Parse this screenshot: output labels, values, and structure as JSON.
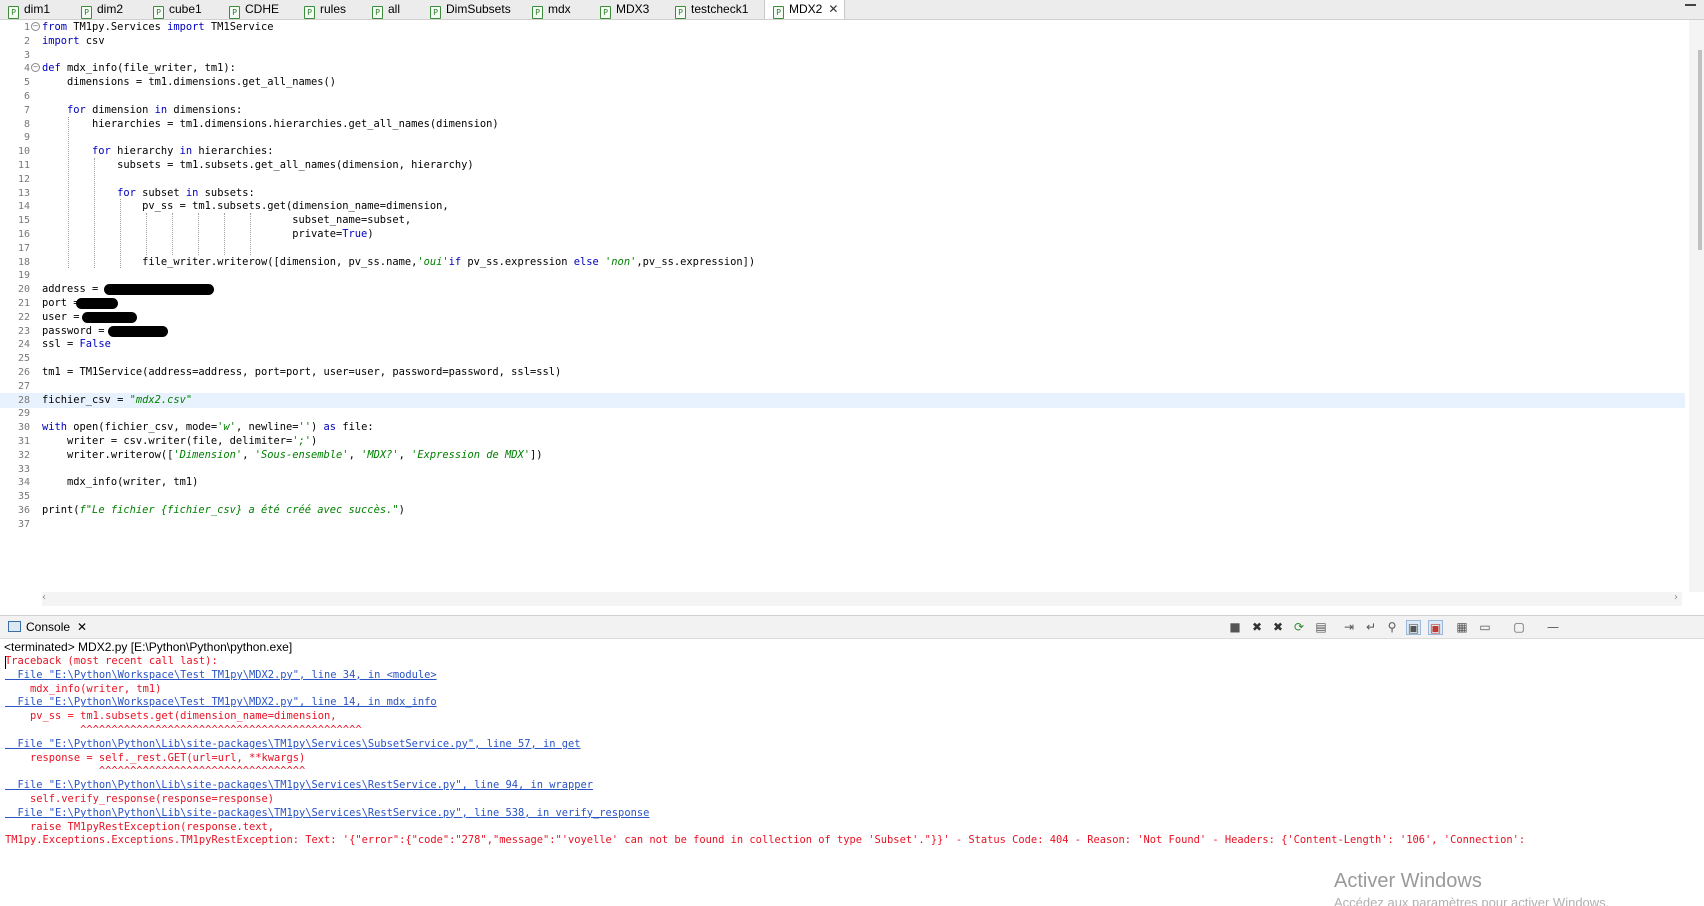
{
  "tabs": [
    {
      "label": "dim1",
      "icon": "python-file-icon",
      "active": false
    },
    {
      "label": "dim2",
      "icon": "python-file-icon",
      "active": false
    },
    {
      "label": "cube1",
      "icon": "python-file-icon",
      "active": false
    },
    {
      "label": "CDHE",
      "icon": "python-file-icon",
      "active": false
    },
    {
      "label": "rules",
      "icon": "python-file-icon",
      "active": false
    },
    {
      "label": "all",
      "icon": "python-file-icon",
      "active": false
    },
    {
      "label": "DimSubsets",
      "icon": "python-file-icon",
      "active": false
    },
    {
      "label": "mdx",
      "icon": "python-file-icon",
      "active": false
    },
    {
      "label": "MDX3",
      "icon": "python-file-icon",
      "active": false
    },
    {
      "label": "testcheck1",
      "icon": "python-file-icon",
      "active": false
    },
    {
      "label": "MDX2",
      "icon": "python-file-icon",
      "active": true
    }
  ],
  "editor": {
    "current_line": 28,
    "lines": [
      {
        "n": "1",
        "fold": true,
        "code": "from TM1py.Services import TM1Service"
      },
      {
        "n": "2",
        "code": "import csv"
      },
      {
        "n": "3",
        "code": ""
      },
      {
        "n": "4",
        "fold": true,
        "code": "def mdx_info(file_writer, tm1):"
      },
      {
        "n": "5",
        "code": "    dimensions = tm1.dimensions.get_all_names()"
      },
      {
        "n": "6",
        "code": ""
      },
      {
        "n": "7",
        "code": "    for dimension in dimensions:"
      },
      {
        "n": "8",
        "code": "        hierarchies = tm1.dimensions.hierarchies.get_all_names(dimension)"
      },
      {
        "n": "9",
        "code": ""
      },
      {
        "n": "10",
        "code": "        for hierarchy in hierarchies:"
      },
      {
        "n": "11",
        "code": "            subsets = tm1.subsets.get_all_names(dimension, hierarchy)"
      },
      {
        "n": "12",
        "code": ""
      },
      {
        "n": "13",
        "code": "            for subset in subsets:"
      },
      {
        "n": "14",
        "code": "                pv_ss = tm1.subsets.get(dimension_name=dimension,"
      },
      {
        "n": "15",
        "code": "                                        subset_name=subset,"
      },
      {
        "n": "16",
        "code": "                                        private=True)"
      },
      {
        "n": "17",
        "code": ""
      },
      {
        "n": "18",
        "code": "                file_writer.writerow([dimension, pv_ss.name,'oui'if pv_ss.expression else 'non',pv_ss.expression])"
      },
      {
        "n": "19",
        "code": ""
      },
      {
        "n": "20",
        "code": "address = "
      },
      {
        "n": "21",
        "code": "port = "
      },
      {
        "n": "22",
        "code": "user = "
      },
      {
        "n": "23",
        "code": "password = "
      },
      {
        "n": "24",
        "code": "ssl = False"
      },
      {
        "n": "25",
        "code": ""
      },
      {
        "n": "26",
        "code": "tm1 = TM1Service(address=address, port=port, user=user, password=password, ssl=ssl)"
      },
      {
        "n": "27",
        "code": ""
      },
      {
        "n": "28",
        "code": "fichier_csv = \"mdx2.csv\""
      },
      {
        "n": "29",
        "code": ""
      },
      {
        "n": "30",
        "code": "with open(fichier_csv, mode='w', newline='') as file:"
      },
      {
        "n": "31",
        "code": "    writer = csv.writer(file, delimiter=';')"
      },
      {
        "n": "32",
        "code": "    writer.writerow(['Dimension', 'Sous-ensemble', 'MDX?', 'Expression de MDX'])"
      },
      {
        "n": "33",
        "code": ""
      },
      {
        "n": "34",
        "code": "    mdx_info(writer, tm1)"
      },
      {
        "n": "35",
        "code": ""
      },
      {
        "n": "36",
        "code": "print(f\"Le fichier {fichier_csv} a été créé avec succès.\")"
      },
      {
        "n": "37",
        "code": ""
      }
    ]
  },
  "console": {
    "tab_label": "Console",
    "status": "<terminated> MDX2.py [E:\\Python\\Python\\python.exe]",
    "output": [
      {
        "text": "Traceback (most recent call last):",
        "kind": "error"
      },
      {
        "text": "  File \"E:\\Python\\Workspace\\Test TM1py\\MDX2.py\", line 34, in <module>",
        "kind": "link"
      },
      {
        "text": "    mdx_info(writer, tm1)",
        "kind": "error"
      },
      {
        "text": "  File \"E:\\Python\\Workspace\\Test TM1py\\MDX2.py\", line 14, in mdx_info",
        "kind": "link"
      },
      {
        "text": "    pv_ss = tm1.subsets.get(dimension_name=dimension,",
        "kind": "error"
      },
      {
        "text": "            ^^^^^^^^^^^^^^^^^^^^^^^^^^^^^^^^^^^^^^^^^^^^^",
        "kind": "error"
      },
      {
        "text": "  File \"E:\\Python\\Python\\Lib\\site-packages\\TM1py\\Services\\SubsetService.py\", line 57, in get",
        "kind": "link"
      },
      {
        "text": "    response = self._rest.GET(url=url, **kwargs)",
        "kind": "error"
      },
      {
        "text": "               ^^^^^^^^^^^^^^^^^^^^^^^^^^^^^^^^^",
        "kind": "error"
      },
      {
        "text": "  File \"E:\\Python\\Python\\Lib\\site-packages\\TM1py\\Services\\RestService.py\", line 94, in wrapper",
        "kind": "link"
      },
      {
        "text": "    self.verify_response(response=response)",
        "kind": "error"
      },
      {
        "text": "  File \"E:\\Python\\Python\\Lib\\site-packages\\TM1py\\Services\\RestService.py\", line 538, in verify_response",
        "kind": "link"
      },
      {
        "text": "    raise TM1pyRestException(response.text,",
        "kind": "error"
      },
      {
        "text": "TM1py.Exceptions.Exceptions.TM1pyRestException: Text: '{\"error\":{\"code\":\"278\",\"message\":\"'voyelle' can not be found in collection of type 'Subset'.\"}}' - Status Code: 404 - Reason: 'Not Found' - Headers: {'Content-Length': '106', 'Connection':",
        "kind": "error"
      }
    ],
    "toolbar": [
      "terminate-icon",
      "remove-launch-icon",
      "remove-all-terminated-icon",
      "relaunch-icon",
      "clear-console-icon",
      "scroll-lock-icon",
      "word-wrap-icon",
      "pin-console-icon",
      "show-stdout-icon",
      "show-stderr-icon",
      "new-console-icon",
      "display-console-icon",
      "open-console-icon",
      "minimize-icon"
    ]
  },
  "watermark": {
    "line1": "Activer Windows",
    "line2": "Accédez aux paramètres pour activer Windows."
  }
}
